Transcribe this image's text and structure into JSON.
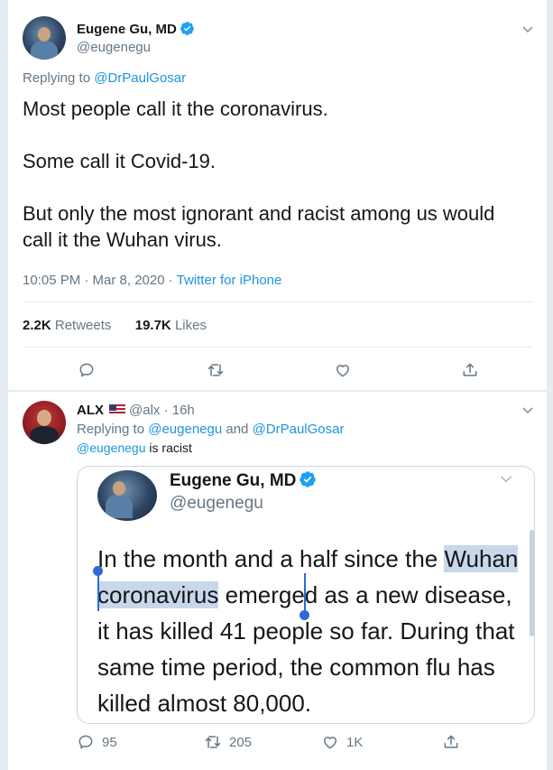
{
  "colors": {
    "accent": "#1b95e0",
    "muted": "#657786",
    "text": "#14171a",
    "border": "#e6ecf0",
    "selection": "#c8d7ea",
    "like_icon": "#657786"
  },
  "main_tweet": {
    "author_name": "Eugene Gu, MD",
    "handle": "@eugenegu",
    "replying_prefix": "Replying to ",
    "replying_to": "@DrPaulGosar",
    "body_lines": [
      "Most people call it the coronavirus.",
      "Some call it Covid-19.",
      "But only the most ignorant and racist among us would call it the Wuhan virus."
    ],
    "timestamp": "10:05 PM · Mar 8, 2020 · ",
    "source": "Twitter for iPhone",
    "retweets_count": "2.2K",
    "retweets_label": "Retweets",
    "likes_count": "19.7K",
    "likes_label": "Likes",
    "icons": [
      "reply-icon",
      "retweet-icon",
      "like-icon",
      "share-icon"
    ]
  },
  "reply_tweet": {
    "author_name": "ALX",
    "handle_time": "@alx · 16h",
    "replying_prefix": "Replying to ",
    "replying_to_1": "@eugenegu",
    "replying_and": " and ",
    "replying_to_2": "@DrPaulGosar",
    "body_mention": "@eugenegu",
    "body_rest": " is racist",
    "reply_count": "95",
    "retweet_count": "205",
    "like_count": "1K"
  },
  "embedded_screenshot": {
    "author_name": "Eugene Gu, MD",
    "handle": "@eugenegu",
    "text_before": "In the month and a half since the ",
    "text_selected": "Wuhan coronavirus",
    "text_after": " emerged as a new disease, it has killed 41 people so far. During that same time period, the common flu has killed almost 80,000."
  }
}
